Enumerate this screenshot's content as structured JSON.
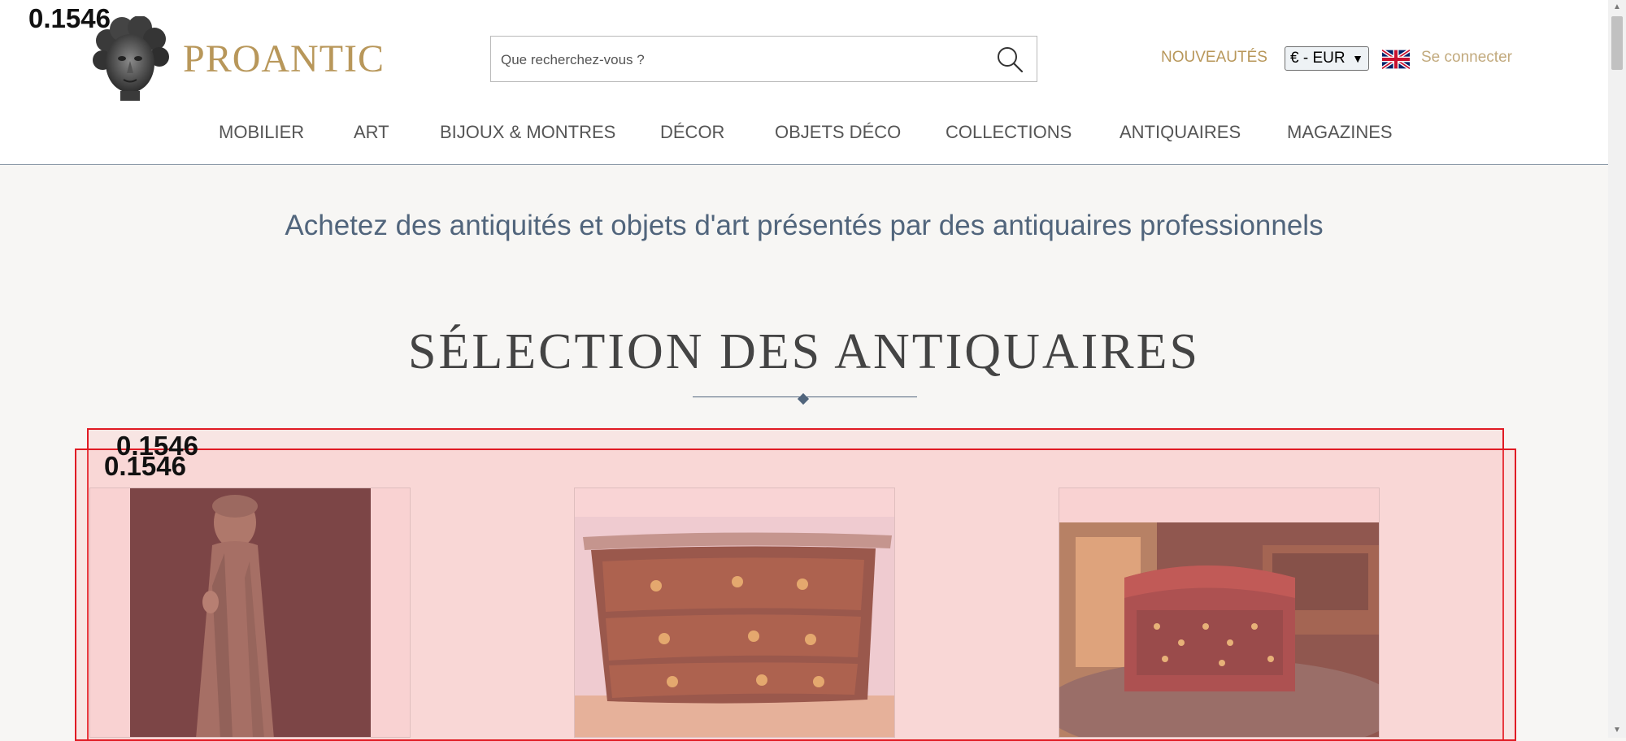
{
  "header": {
    "logo_text": "PROANTIC",
    "search_placeholder": "Que recherchez-vous ?",
    "nouveautes_label": "NOUVEAUTÉS",
    "currency_selected": "€ - EUR",
    "login_label": "Se connecter"
  },
  "nav": {
    "items": [
      "MOBILIER",
      "ART",
      "BIJOUX & MONTRES",
      "DÉCOR",
      "OBJETS DÉCO",
      "COLLECTIONS",
      "ANTIQUAIRES",
      "MAGAZINES"
    ]
  },
  "main": {
    "tagline": "Achetez des antiquités et objets d'art présentés par des antiquaires professionnels",
    "section_title": "SÉLECTION DES ANTIQUAIRES"
  },
  "overlay": {
    "scores": [
      "0.1546",
      "0.1546",
      "0.1546"
    ],
    "color": "#e01b24"
  },
  "colors": {
    "brand_gold": "#b8975a",
    "tagline_blue": "#51657c"
  }
}
